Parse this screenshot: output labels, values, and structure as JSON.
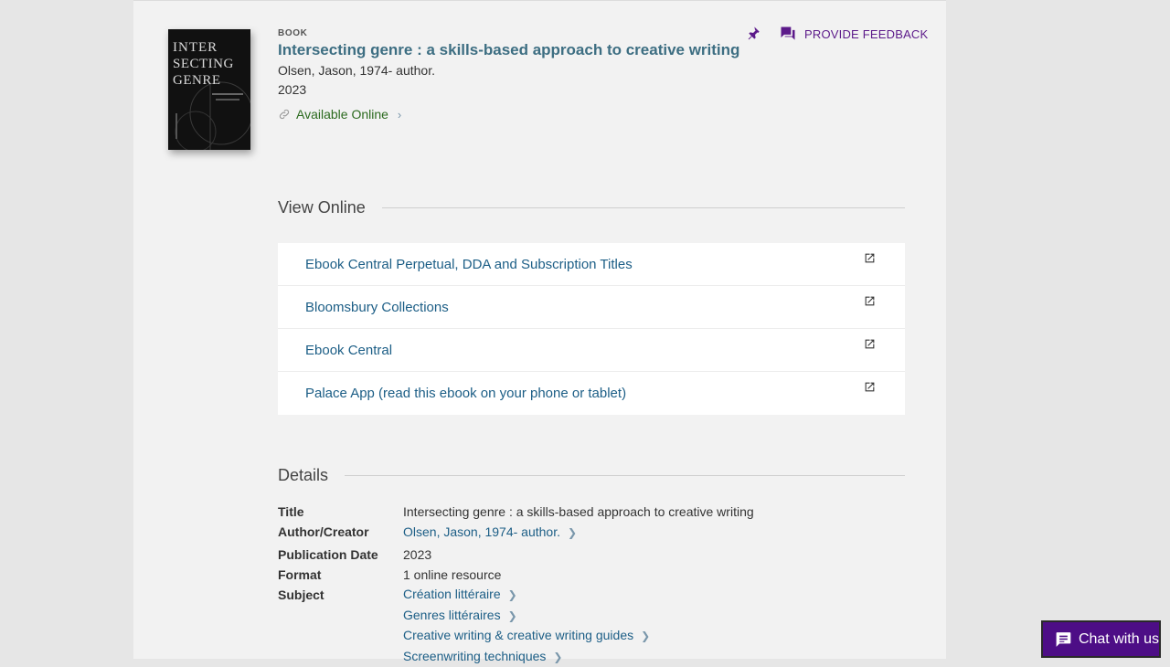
{
  "record": {
    "type": "BOOK",
    "title": "Intersecting genre : a skills-based approach to creative writing",
    "author": "Olsen, Jason, 1974- author.",
    "year": "2023",
    "availability": "Available Online"
  },
  "cover": {
    "line1": "INTER",
    "line2": "SECTING",
    "line3": "GENRE"
  },
  "actions": {
    "feedback_label": "PROVIDE FEEDBACK"
  },
  "view_online": {
    "heading": "View Online",
    "links": [
      {
        "label": "Ebook Central Perpetual, DDA and Subscription Titles"
      },
      {
        "label": "Bloomsbury Collections"
      },
      {
        "label": "Ebook Central"
      },
      {
        "label": "Palace App (read this ebook on your phone or tablet)"
      }
    ]
  },
  "details": {
    "heading": "Details",
    "title_label": "Title",
    "title_value": "Intersecting genre : a skills-based approach to creative writing",
    "author_label": "Author/Creator",
    "author_value": "Olsen, Jason, 1974- author.",
    "date_label": "Publication Date",
    "date_value": "2023",
    "format_label": "Format",
    "format_value": "1 online resource",
    "subject_label": "Subject",
    "subjects": [
      "Création littéraire",
      "Genres littéraires",
      "Creative writing & creative writing guides",
      "Screenwriting techniques"
    ]
  },
  "chat": {
    "label": "Chat with us"
  },
  "colors": {
    "title": "#3d6e82",
    "link": "#1c5e86",
    "available": "#2b6a1e",
    "accent_purple": "#5c1a8a",
    "chat_bg": "#4d0e86"
  }
}
